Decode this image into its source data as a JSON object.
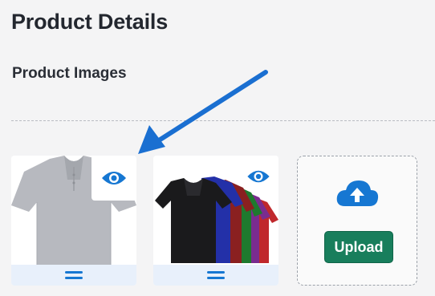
{
  "header": {
    "title": "Product Details"
  },
  "section": {
    "title": "Product Images"
  },
  "images": [
    {
      "alt": "Grey polo shirt",
      "icon": "eye-icon",
      "handle_icon": "drag-handle-icon"
    },
    {
      "alt": "Polo shirts in several colors",
      "icon": "eye-icon",
      "handle_icon": "drag-handle-icon"
    }
  ],
  "upload": {
    "icon": "cloud-upload-icon",
    "button_label": "Upload"
  },
  "colors": {
    "accent": "#1677d2",
    "upload_button": "#187e5c",
    "handle_bg": "#e8f0fb"
  }
}
